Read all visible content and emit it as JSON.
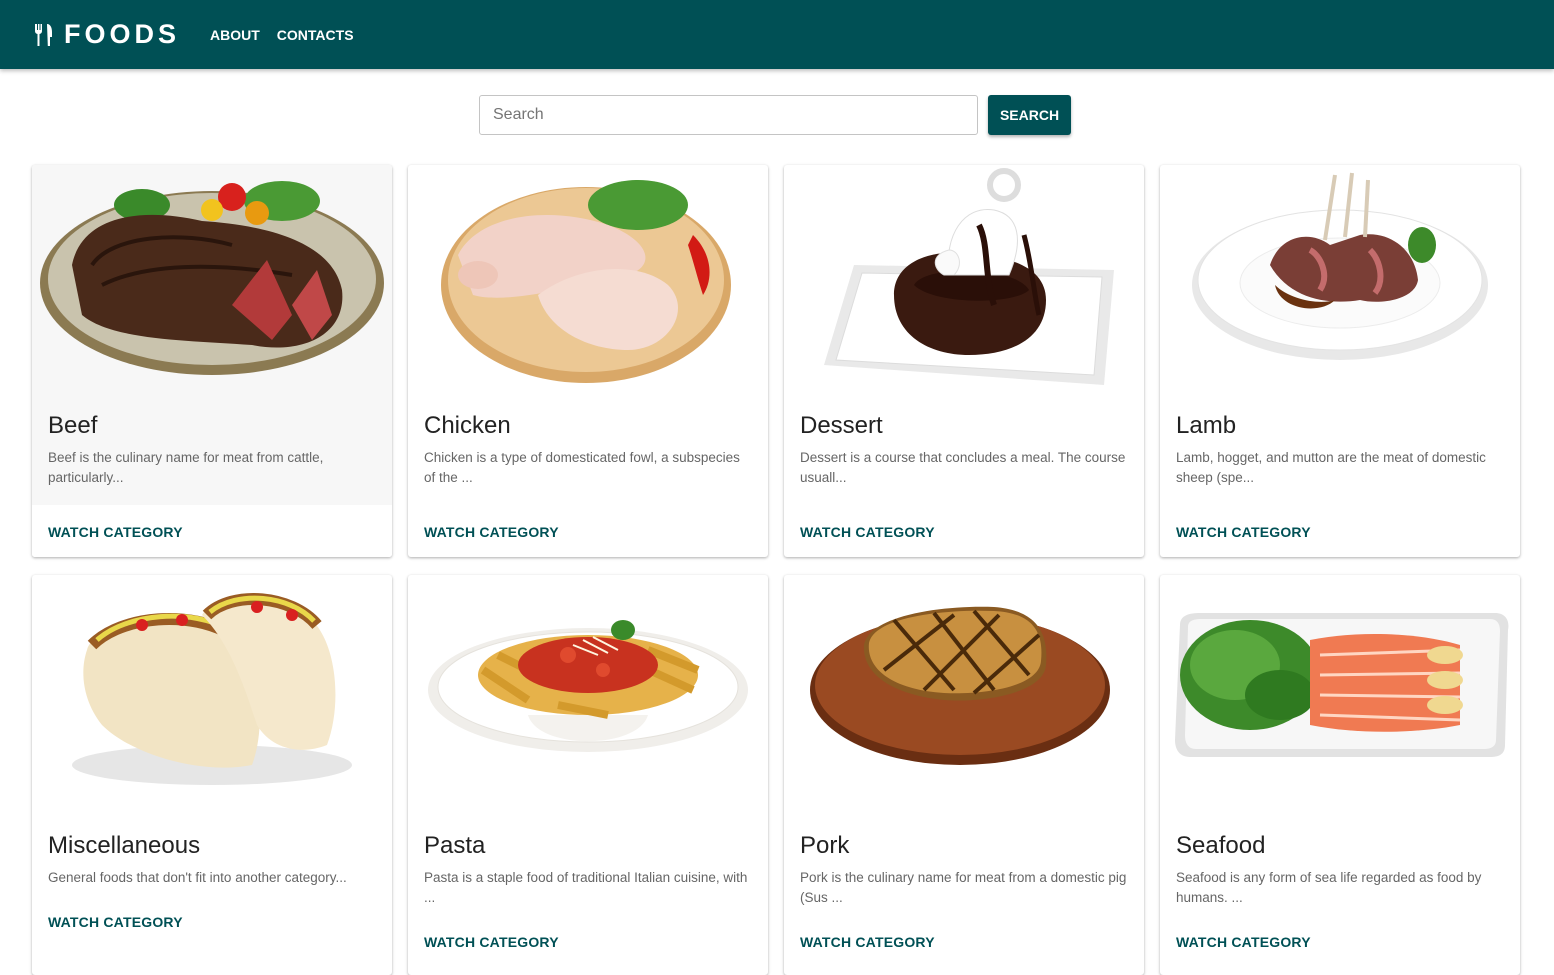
{
  "header": {
    "brand": "FOODS",
    "nav": [
      {
        "label": "ABOUT"
      },
      {
        "label": "CONTACTS"
      }
    ]
  },
  "search": {
    "placeholder": "Search",
    "value": "",
    "button_label": "SEARCH"
  },
  "categories": [
    {
      "title": "Beef",
      "description": "Beef is the culinary name for meat from cattle, particularly...",
      "action": "WATCH CATEGORY"
    },
    {
      "title": "Chicken",
      "description": "Chicken is a type of domesticated fowl, a subspecies of the ...",
      "action": "WATCH CATEGORY"
    },
    {
      "title": "Dessert",
      "description": "Dessert is a course that concludes a meal. The course usuall...",
      "action": "WATCH CATEGORY"
    },
    {
      "title": "Lamb",
      "description": "Lamb, hogget, and mutton are the meat of domestic sheep (spe...",
      "action": "WATCH CATEGORY"
    },
    {
      "title": "Miscellaneous",
      "description": "General foods that don't fit into another category...",
      "action": "WATCH CATEGORY"
    },
    {
      "title": "Pasta",
      "description": "Pasta is a staple food of traditional Italian cuisine, with ...",
      "action": "WATCH CATEGORY"
    },
    {
      "title": "Pork",
      "description": "Pork is the culinary name for meat from a domestic pig (Sus ...",
      "action": "WATCH CATEGORY"
    },
    {
      "title": "Seafood",
      "description": "Seafood is any form of sea life regarded as food by humans. ...",
      "action": "WATCH CATEGORY"
    }
  ],
  "colors": {
    "brand": "#005055",
    "background": "#ffffff",
    "text_secondary": "#666666"
  },
  "icons": {
    "brand_icon": "fork-knife-icon"
  }
}
